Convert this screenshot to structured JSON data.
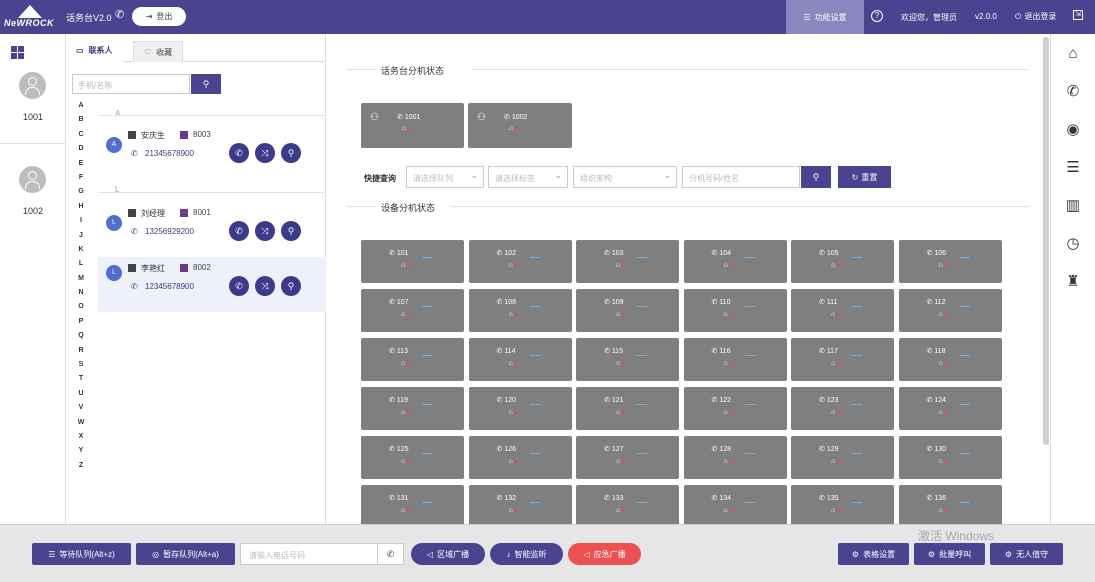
{
  "topbar": {
    "logo_text": "NeWROCK",
    "app_title": "话务台V2.0",
    "logout_label": "登出",
    "func_settings_label": "功能设置",
    "welcome": "欢迎您，管理员",
    "version": "v2.0.0",
    "logoff_label": "退出登录"
  },
  "left_users": [
    "1001",
    "1002"
  ],
  "contacts": {
    "tab_contacts": "联系人",
    "tab_favorites": "收藏",
    "search_placeholder": "手机/名称",
    "alphabet": [
      "A",
      "B",
      "C",
      "D",
      "E",
      "F",
      "G",
      "H",
      "I",
      "J",
      "K",
      "L",
      "M",
      "N",
      "O",
      "P",
      "Q",
      "R",
      "S",
      "T",
      "U",
      "V",
      "W",
      "X",
      "Y",
      "Z"
    ],
    "groups": [
      {
        "letter": "A",
        "items": [
          {
            "initial": "A",
            "name": "安庆生",
            "ext": "8003",
            "phone": "21345678900"
          }
        ]
      },
      {
        "letter": "L",
        "items": [
          {
            "initial": "L",
            "name": "刘经理",
            "ext": "8001",
            "phone": "13256929200"
          },
          {
            "initial": "L",
            "name": "李艳红",
            "ext": "8002",
            "phone": "12345678900"
          }
        ]
      }
    ]
  },
  "main": {
    "operator_title": "话务台分机状态",
    "operator_exts": [
      "1001",
      "1002"
    ],
    "filter_label": "快捷查询",
    "filter_selects": [
      "请选择队列",
      "请选择标签",
      "组织架构"
    ],
    "filter_input_placeholder": "分机号码/姓名",
    "reset_label": "重置",
    "device_title": "设备分机状态",
    "devices": [
      "101",
      "102",
      "103",
      "104",
      "105",
      "106",
      "107",
      "108",
      "109",
      "110",
      "111",
      "112",
      "113",
      "114",
      "115",
      "116",
      "117",
      "118",
      "119",
      "120",
      "121",
      "122",
      "123",
      "124",
      "125",
      "126",
      "127",
      "128",
      "129",
      "130",
      "131",
      "132",
      "133",
      "134",
      "135",
      "136"
    ]
  },
  "bottom": {
    "wait_queue": "等待队列(Alt+z)",
    "hold_queue": "暂存队列(Alt+a)",
    "phone_placeholder": "请输入电话号码",
    "zone_broadcast": "区域广播",
    "smart_listen": "智能监听",
    "emergency_broadcast": "应急广播",
    "table_settings": "表格设置",
    "batch_call": "批量呼叫",
    "unattended": "无人值守",
    "watermark": "激活 Windows"
  },
  "colors": {
    "primary": "#4a4490",
    "tile": "#7f7f7f",
    "emergency": "#ec5050",
    "func_active": "#8a86c0"
  }
}
